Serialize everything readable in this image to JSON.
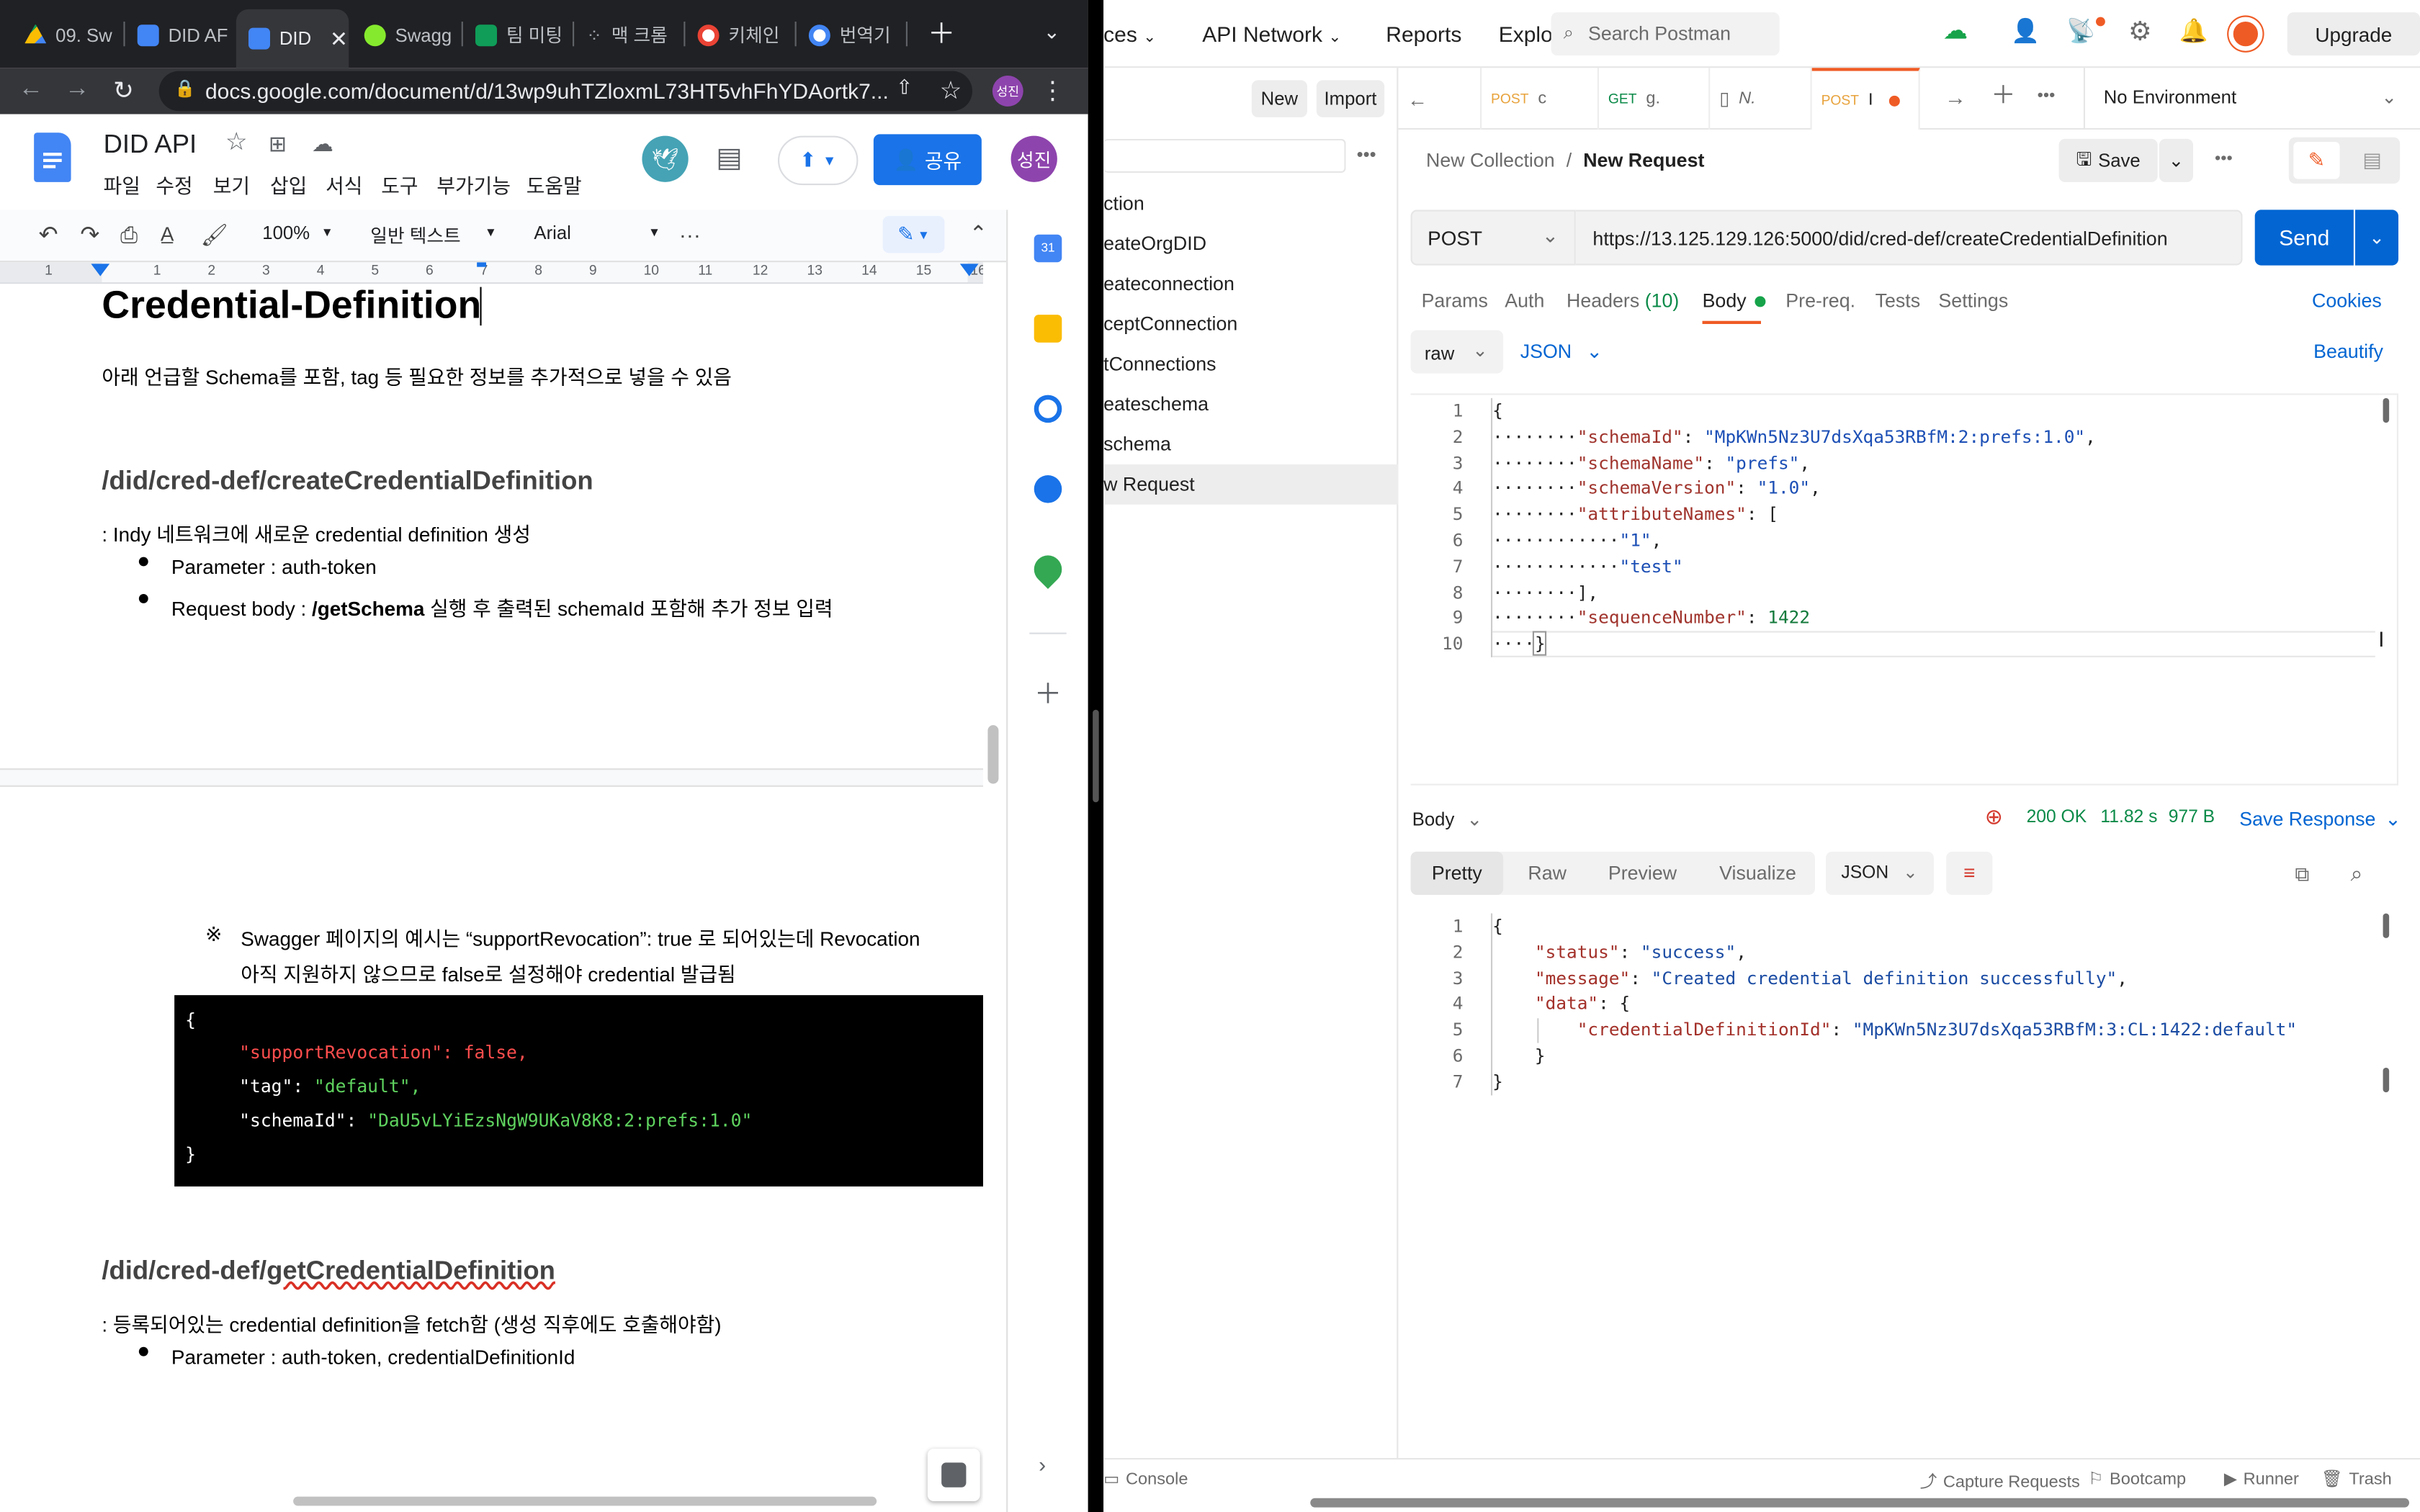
{
  "chrome": {
    "tabs": [
      {
        "label": "09. Sw",
        "color": "#fbbc04"
      },
      {
        "label": "DID AF",
        "color": "#4285f4"
      },
      {
        "label": "DID",
        "color": "#4285f4"
      },
      {
        "label": "Swagg",
        "color": "#85ea2d"
      },
      {
        "label": "팀 미팅",
        "color": "#0f9d58"
      },
      {
        "label": "맥 크롬",
        "color": "#9aa0a6"
      },
      {
        "label": "키체인",
        "color": "#ffffff"
      },
      {
        "label": "번역기",
        "color": "#ffffff"
      }
    ],
    "url": "docs.google.com/document/d/13wp9uhTZloxmL73HT5vhFhYDAortk7...",
    "avatar": "성진"
  },
  "docs": {
    "title": "DID API",
    "menu": [
      "파일",
      "수정",
      "보기",
      "삽입",
      "서식",
      "도구",
      "부가기능",
      "도움말"
    ],
    "share": "공유",
    "toolbar": {
      "zoom": "100%",
      "style": "일반 텍스트",
      "font": "Arial",
      "more": "···"
    },
    "ruler_marks": [
      "1",
      "1",
      "2",
      "3",
      "4",
      "5",
      "6",
      "7",
      "8",
      "9",
      "10",
      "11",
      "12",
      "13",
      "14",
      "15",
      "16"
    ],
    "heading": "Credential-Definition",
    "intro": "아래 언급할 Schema를 포함, tag 등 필요한 정보를 추가적으로 넣을 수 있음",
    "section1": {
      "title": "/did/cred-def/createCredentialDefinition",
      "desc": ": Indy 네트워크에 새로운 credential definition 생성",
      "bullet1": "Parameter : auth-token",
      "bullet2_pre": "Request body : ",
      "bullet2_bold": "/getSchema",
      "bullet2_post": " 실행 후 출력된 schemaId 포함해 추가 정보 입력"
    },
    "note_mark": "※",
    "note_line1": "Swagger 페이지의 예시는 “supportRevocation”: true 로 되어있는데 Revocation",
    "note_line2": "아직 지원하지 않으므로 false로 설정해야 credential 발급됨",
    "codeblock": {
      "open": "{",
      "l1": "\"supportRevocation\": false,",
      "l2_key": "\"tag\": ",
      "l2_val": "\"default\",",
      "l3_key": "\"schemaId\": ",
      "l3_val": "\"DaU5vLYiEzsNgW9UKaV8K8:2:prefs:1.0\"",
      "close": "}"
    },
    "section2": {
      "title_pre": "/did/cred-def/",
      "title_u": "getCredentialDefinition",
      "desc": ": 등록되어있는 credential definition을 fetch함 (생성 직후에도 호출해야함)",
      "bullet1": "Parameter : auth-token, credentialDefinitionId"
    }
  },
  "postman": {
    "nav": {
      "item0": "ces",
      "item1": "API Network",
      "item2": "Reports",
      "item3": "Explo",
      "search": "Search Postman",
      "upgrade": "Upgrade"
    },
    "sidebar": {
      "new": "New",
      "import": "Import",
      "items": [
        "ction",
        "eateOrgDID",
        "eateconnection",
        "ceptConnection",
        "tConnections",
        "eateschema",
        "schema",
        "w Request"
      ]
    },
    "tabs": [
      {
        "method": "",
        "label": ""
      },
      {
        "method": "POST",
        "label": "c"
      },
      {
        "method": "GET",
        "label": "g."
      },
      {
        "method": "",
        "label": "N."
      },
      {
        "method": "POST",
        "label": "I"
      }
    ],
    "environment": "No Environment",
    "breadcrumb": {
      "parent": "New Collection",
      "sep": "/",
      "current": "New Request"
    },
    "save": "Save",
    "method": "POST",
    "url": "https://13.125.129.126:5000/did/cred-def/createCredentialDefinition",
    "send": "Send",
    "req_tabs": [
      "Params",
      "Auth",
      "Headers",
      "Body",
      "Pre-req.",
      "Tests",
      "Settings"
    ],
    "headers_count": "(10)",
    "cookies": "Cookies",
    "body_mode": "raw",
    "body_lang": "JSON",
    "beautify": "Beautify",
    "request_lines": [
      "1",
      "2",
      "3",
      "4",
      "5",
      "6",
      "7",
      "8",
      "9",
      "10"
    ],
    "request_body": {
      "k1": "\"schemaId\"",
      "v1": "\"MpKWn5Nz3U7dsXqa53RBfM:2:prefs:1.0\"",
      "k2": "\"schemaName\"",
      "v2": "\"prefs\"",
      "k3": "\"schemaVersion\"",
      "v3": "\"1.0\"",
      "k4": "\"attributeNames\"",
      "a1": "\"1\"",
      "a2": "\"test\"",
      "k5": "\"sequenceNumber\"",
      "v5": "1422"
    },
    "response": {
      "label": "Body",
      "status": "200 OK",
      "time": "11.82 s",
      "size": "977 B",
      "save": "Save Response",
      "views": [
        "Pretty",
        "Raw",
        "Preview",
        "Visualize"
      ],
      "format": "JSON",
      "lines": [
        "1",
        "2",
        "3",
        "4",
        "5",
        "6",
        "7"
      ],
      "k1": "\"status\"",
      "v1": "\"success\"",
      "k2": "\"message\"",
      "v2": "\"Created credential definition successfully\"",
      "k3": "\"data\"",
      "k4": "\"credentialDefinitionId\"",
      "v4": "\"MpKWn5Nz3U7dsXqa53RBfM:3:CL:1422:default\""
    },
    "bottom": {
      "console": "Console",
      "capture": "Capture Requests",
      "bootcamp": "Bootcamp",
      "runner": "Runner",
      "trash": "Trash"
    }
  }
}
